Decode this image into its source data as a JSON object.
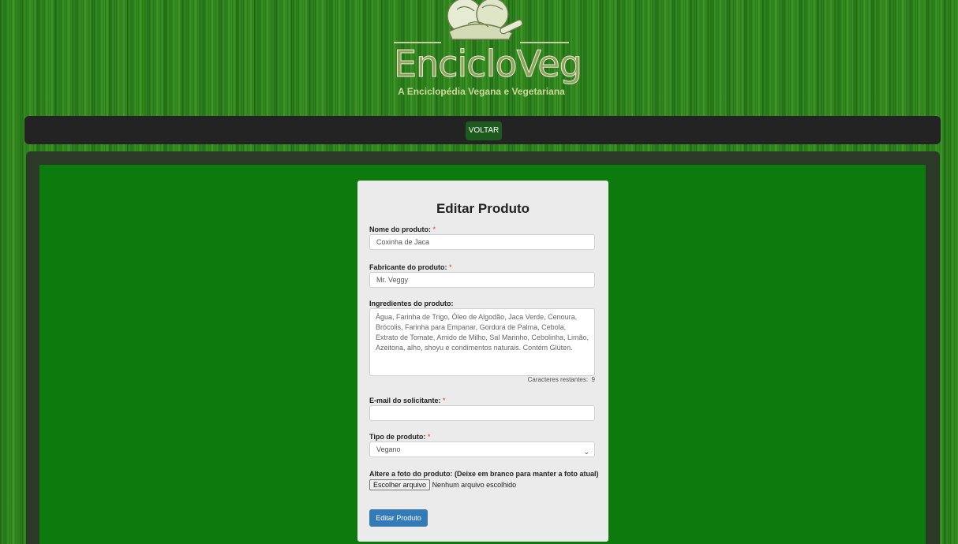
{
  "logo": {
    "title": "EncicloVeg",
    "subtitle": "A Enciclopédia Vegana e Vegetariana"
  },
  "nav": {
    "back_label": "VOLTAR"
  },
  "form": {
    "heading": "Editar Produto",
    "required_mark": "*",
    "name_label": "Nome do produto:",
    "name_value": "Coxinha de Jaca",
    "maker_label": "Fabricante do produto:",
    "maker_value": "Mr. Veggy",
    "ingredients_label": "Ingredientes do produto:",
    "ingredients_value": "Água, Farinha de Trigo, Óleo de Algodão, Jaca Verde, Cenoura, Brócolis, Farinha para Empanar, Gordura de Palma, Cebola, Extrato de Tomate, Amido de Milho, Sal Marinho, Cebolinha, Limão, Azeitona, alho, shoyu e condimentos naturais. Contém Glúten.",
    "counter_label": "Caracteres restantes:",
    "counter_value": "9",
    "email_label": "E-mail do solicitante:",
    "email_value": "",
    "type_label": "Tipo de produto:",
    "type_value": "Vegano",
    "photo_label": "Altere a foto do produto: (Deixe em branco para manter a foto atual)",
    "file_button": "Escolher arquivo",
    "file_status": "Nenhum arquivo escolhido",
    "submit_label": "Editar Produto"
  },
  "colors": {
    "background": "#2f8a1c",
    "navbar": "#232323",
    "panel": "#0d7a0d",
    "card": "#ebebeb",
    "submit": "#337ab7"
  }
}
